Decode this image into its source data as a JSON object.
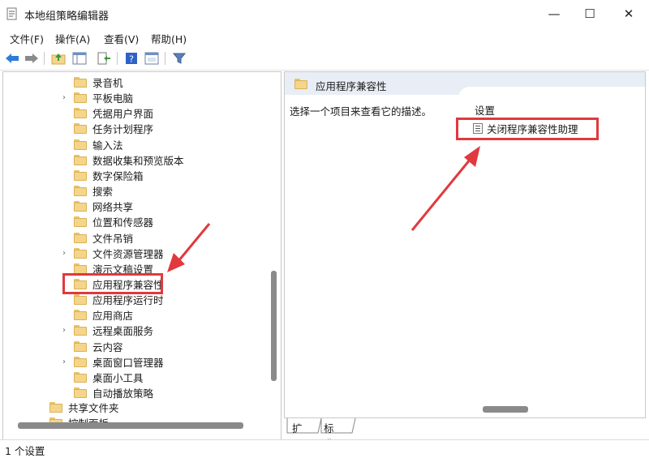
{
  "window": {
    "title": "本地组策略编辑器",
    "minimize": "—",
    "maximize": "☐",
    "close": "✕"
  },
  "menu": [
    "文件(F)",
    "操作(A)",
    "查看(V)",
    "帮助(H)"
  ],
  "tree": [
    {
      "label": "录音机",
      "expandable": false
    },
    {
      "label": "平板电脑",
      "expandable": true
    },
    {
      "label": "凭据用户界面",
      "expandable": false
    },
    {
      "label": "任务计划程序",
      "expandable": false
    },
    {
      "label": "输入法",
      "expandable": false
    },
    {
      "label": "数据收集和预览版本",
      "expandable": false
    },
    {
      "label": "数字保险箱",
      "expandable": false
    },
    {
      "label": "搜索",
      "expandable": false
    },
    {
      "label": "网络共享",
      "expandable": false
    },
    {
      "label": "位置和传感器",
      "expandable": false
    },
    {
      "label": "文件吊销",
      "expandable": false
    },
    {
      "label": "文件资源管理器",
      "expandable": true
    },
    {
      "label": "演示文稿设置",
      "expandable": false
    },
    {
      "label": "应用程序兼容性",
      "expandable": false,
      "selected": true
    },
    {
      "label": "应用程序运行时",
      "expandable": false
    },
    {
      "label": "应用商店",
      "expandable": false
    },
    {
      "label": "远程桌面服务",
      "expandable": true
    },
    {
      "label": "云内容",
      "expandable": false
    },
    {
      "label": "桌面窗口管理器",
      "expandable": true
    },
    {
      "label": "桌面小工具",
      "expandable": false
    },
    {
      "label": "自动播放策略",
      "expandable": false
    }
  ],
  "tree_parent": [
    {
      "label": "共享文件夹"
    },
    {
      "label": "控制面板"
    }
  ],
  "right_pane": {
    "header_title": "应用程序兼容性",
    "description": "选择一个项目来查看它的描述。",
    "column_header": "设置",
    "settings": [
      "关闭程序兼容性助理"
    ]
  },
  "tabs": [
    "扩展",
    "标准"
  ],
  "status": "1 个设置",
  "colors": {
    "highlight": "#e0393e",
    "folder": "#f5d58a",
    "header_bg": "#e9eef6"
  }
}
